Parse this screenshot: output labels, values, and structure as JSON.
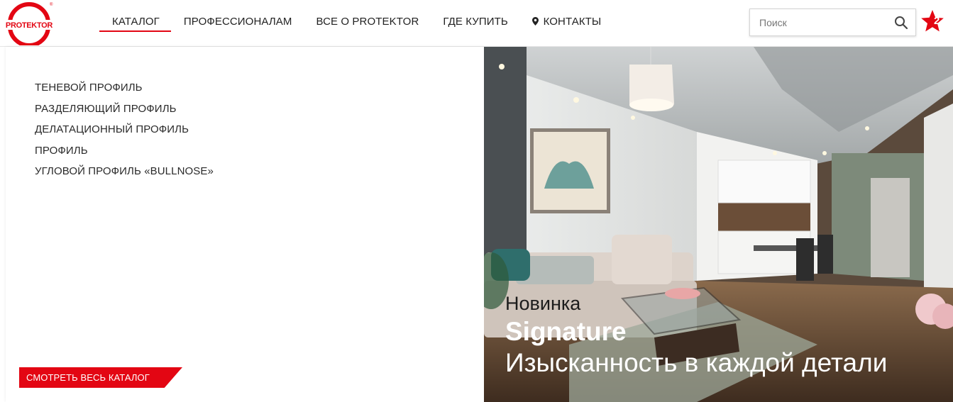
{
  "brand": {
    "name": "PROTEKTOR",
    "reg_mark": "®"
  },
  "nav": {
    "items": [
      {
        "label": "КАТАЛОГ",
        "active": true
      },
      {
        "label": "ПРОФЕССИОНАЛАМ"
      },
      {
        "label": "ВСЕ О PROTEKTOR"
      },
      {
        "label": "ГДЕ КУПИТЬ"
      },
      {
        "label": "КОНТАКТЫ",
        "icon": "map-pin-icon"
      }
    ]
  },
  "search": {
    "placeholder": "Поиск",
    "value": "",
    "icon": "search-icon"
  },
  "favorites": {
    "icon": "star-icon",
    "count": "2"
  },
  "catalog_menu": {
    "items": [
      "ТЕНЕВОЙ ПРОФИЛЬ",
      "РАЗДЕЛЯЮЩИЙ ПРОФИЛЬ",
      "ДЕЛАТАЦИОННЫЙ ПРОФИЛЬ",
      "ПРОФИЛЬ",
      "УГЛОВОЙ ПРОФИЛЬ «BULLNOSE»"
    ],
    "all_button_label": "СМОТРЕТЬ ВЕСЬ КАТАЛОГ"
  },
  "promo": {
    "tag": "Новинка",
    "title": "Signature",
    "subtitle": "Изысканность в каждой детали"
  },
  "colors": {
    "accent": "#e30613",
    "text": "#222222"
  }
}
